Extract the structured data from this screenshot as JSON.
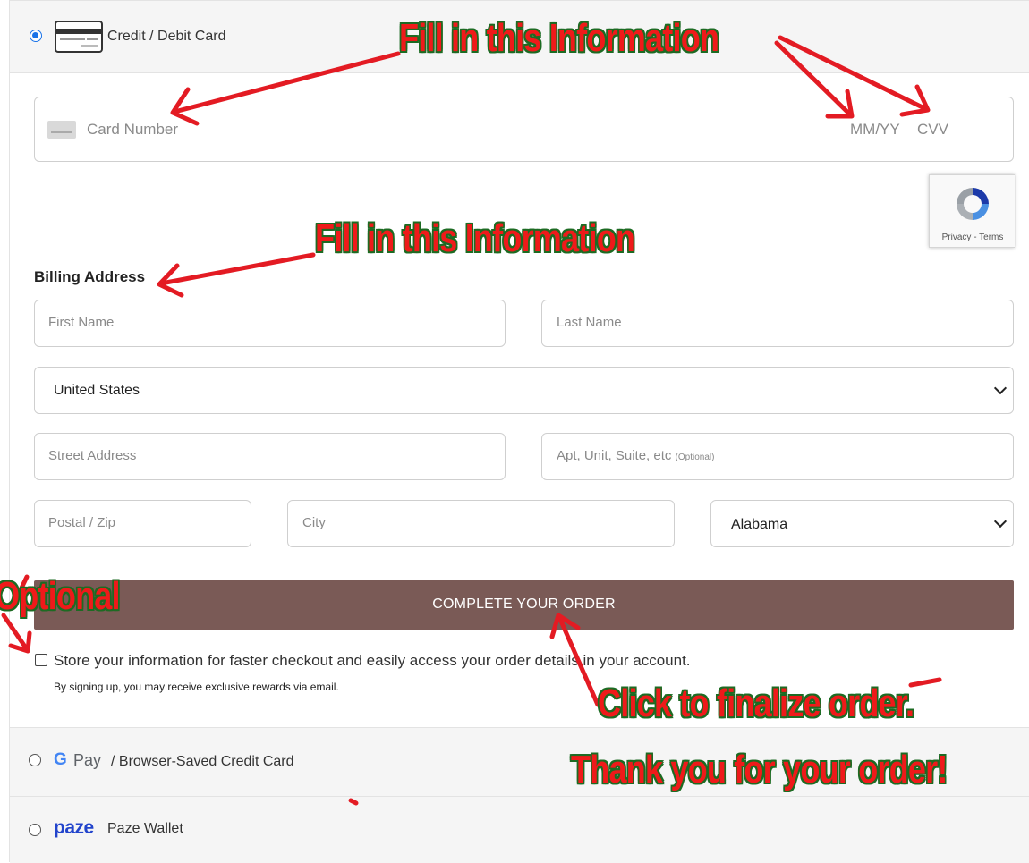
{
  "payment_methods": {
    "card": {
      "label": "Credit / Debit Card"
    },
    "gpay": {
      "brand": "Pay",
      "label": "/ Browser-Saved Credit Card"
    },
    "paze": {
      "brand": "paze",
      "label": "Paze Wallet"
    }
  },
  "card_form": {
    "card_number_placeholder": "Card Number",
    "expiry_placeholder": "MM/YY",
    "cvv_placeholder": "CVV"
  },
  "recaptcha": {
    "privacy": "Privacy",
    "separator": "-",
    "terms": "Terms"
  },
  "billing": {
    "heading": "Billing Address",
    "first_name_placeholder": "First Name",
    "last_name_placeholder": "Last Name",
    "country_value": "United States",
    "street_placeholder": "Street Address",
    "apt_placeholder": "Apt, Unit, Suite, etc",
    "apt_optional": "(Optional)",
    "postal_placeholder": "Postal / Zip",
    "city_placeholder": "City",
    "state_value": "Alabama"
  },
  "order": {
    "complete_label": "COMPLETE YOUR ORDER",
    "store_info_label": "Store your information for faster checkout and easily access your order details in your account.",
    "signup_note": "By signing up, you may receive exclusive rewards via email."
  },
  "annotations": {
    "fill_in_1": "Fill in this Information",
    "fill_in_2": "Fill in this Information",
    "optional": "Optional",
    "click_finalize": "Click to finalize order.",
    "thank_you": "Thank you for your order!"
  },
  "colors": {
    "button_bg": "#7a5a56",
    "radio_checked": "#1a73e8",
    "annotation_fill": "#ef1a1a",
    "annotation_outline": "#1d6b23",
    "paze_blue": "#2244cc"
  }
}
